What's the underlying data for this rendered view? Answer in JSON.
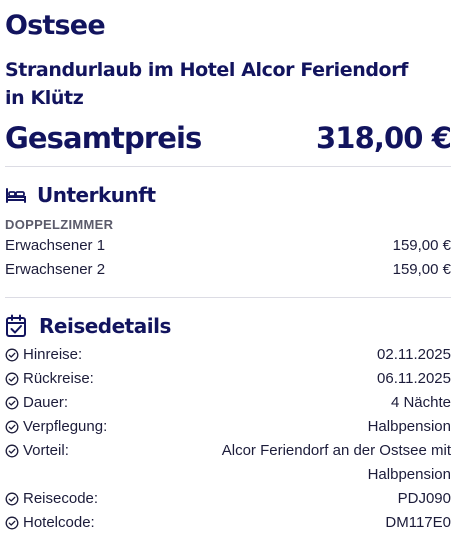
{
  "header": {
    "region": "Ostsee",
    "subtitle": "Strandurlaub im Hotel Alcor Feriendorf in Klütz",
    "total_label": "Gesamtpreis",
    "total_value": "318,00 €"
  },
  "accommodation": {
    "title": "Unterkunft",
    "icon": "bed-icon",
    "room_type": "DOPPELZIMMER",
    "rows": [
      {
        "label": "Erwachsener 1",
        "value": "159,00 €"
      },
      {
        "label": "Erwachsener 2",
        "value": "159,00 €"
      }
    ]
  },
  "details": {
    "title": "Reisedetails",
    "icon": "calendar-check-icon",
    "rows": [
      {
        "label": "Hinreise:",
        "value": "02.11.2025"
      },
      {
        "label": "Rückreise:",
        "value": "06.11.2025"
      },
      {
        "label": "Dauer:",
        "value": "4 Nächte"
      },
      {
        "label": "Verpflegung:",
        "value": "Halbpension"
      },
      {
        "label": "Vorteil:",
        "value": "Alcor Feriendorf an der Ostsee mit Halbpension"
      },
      {
        "label": "Reisecode:",
        "value": "PDJ090"
      },
      {
        "label": "Hotelcode:",
        "value": "DM117E0"
      }
    ]
  },
  "colors": {
    "brand": "#12145e",
    "text": "#1c1c3a",
    "muted": "#5b5b6b",
    "divider": "#dcdce4"
  }
}
